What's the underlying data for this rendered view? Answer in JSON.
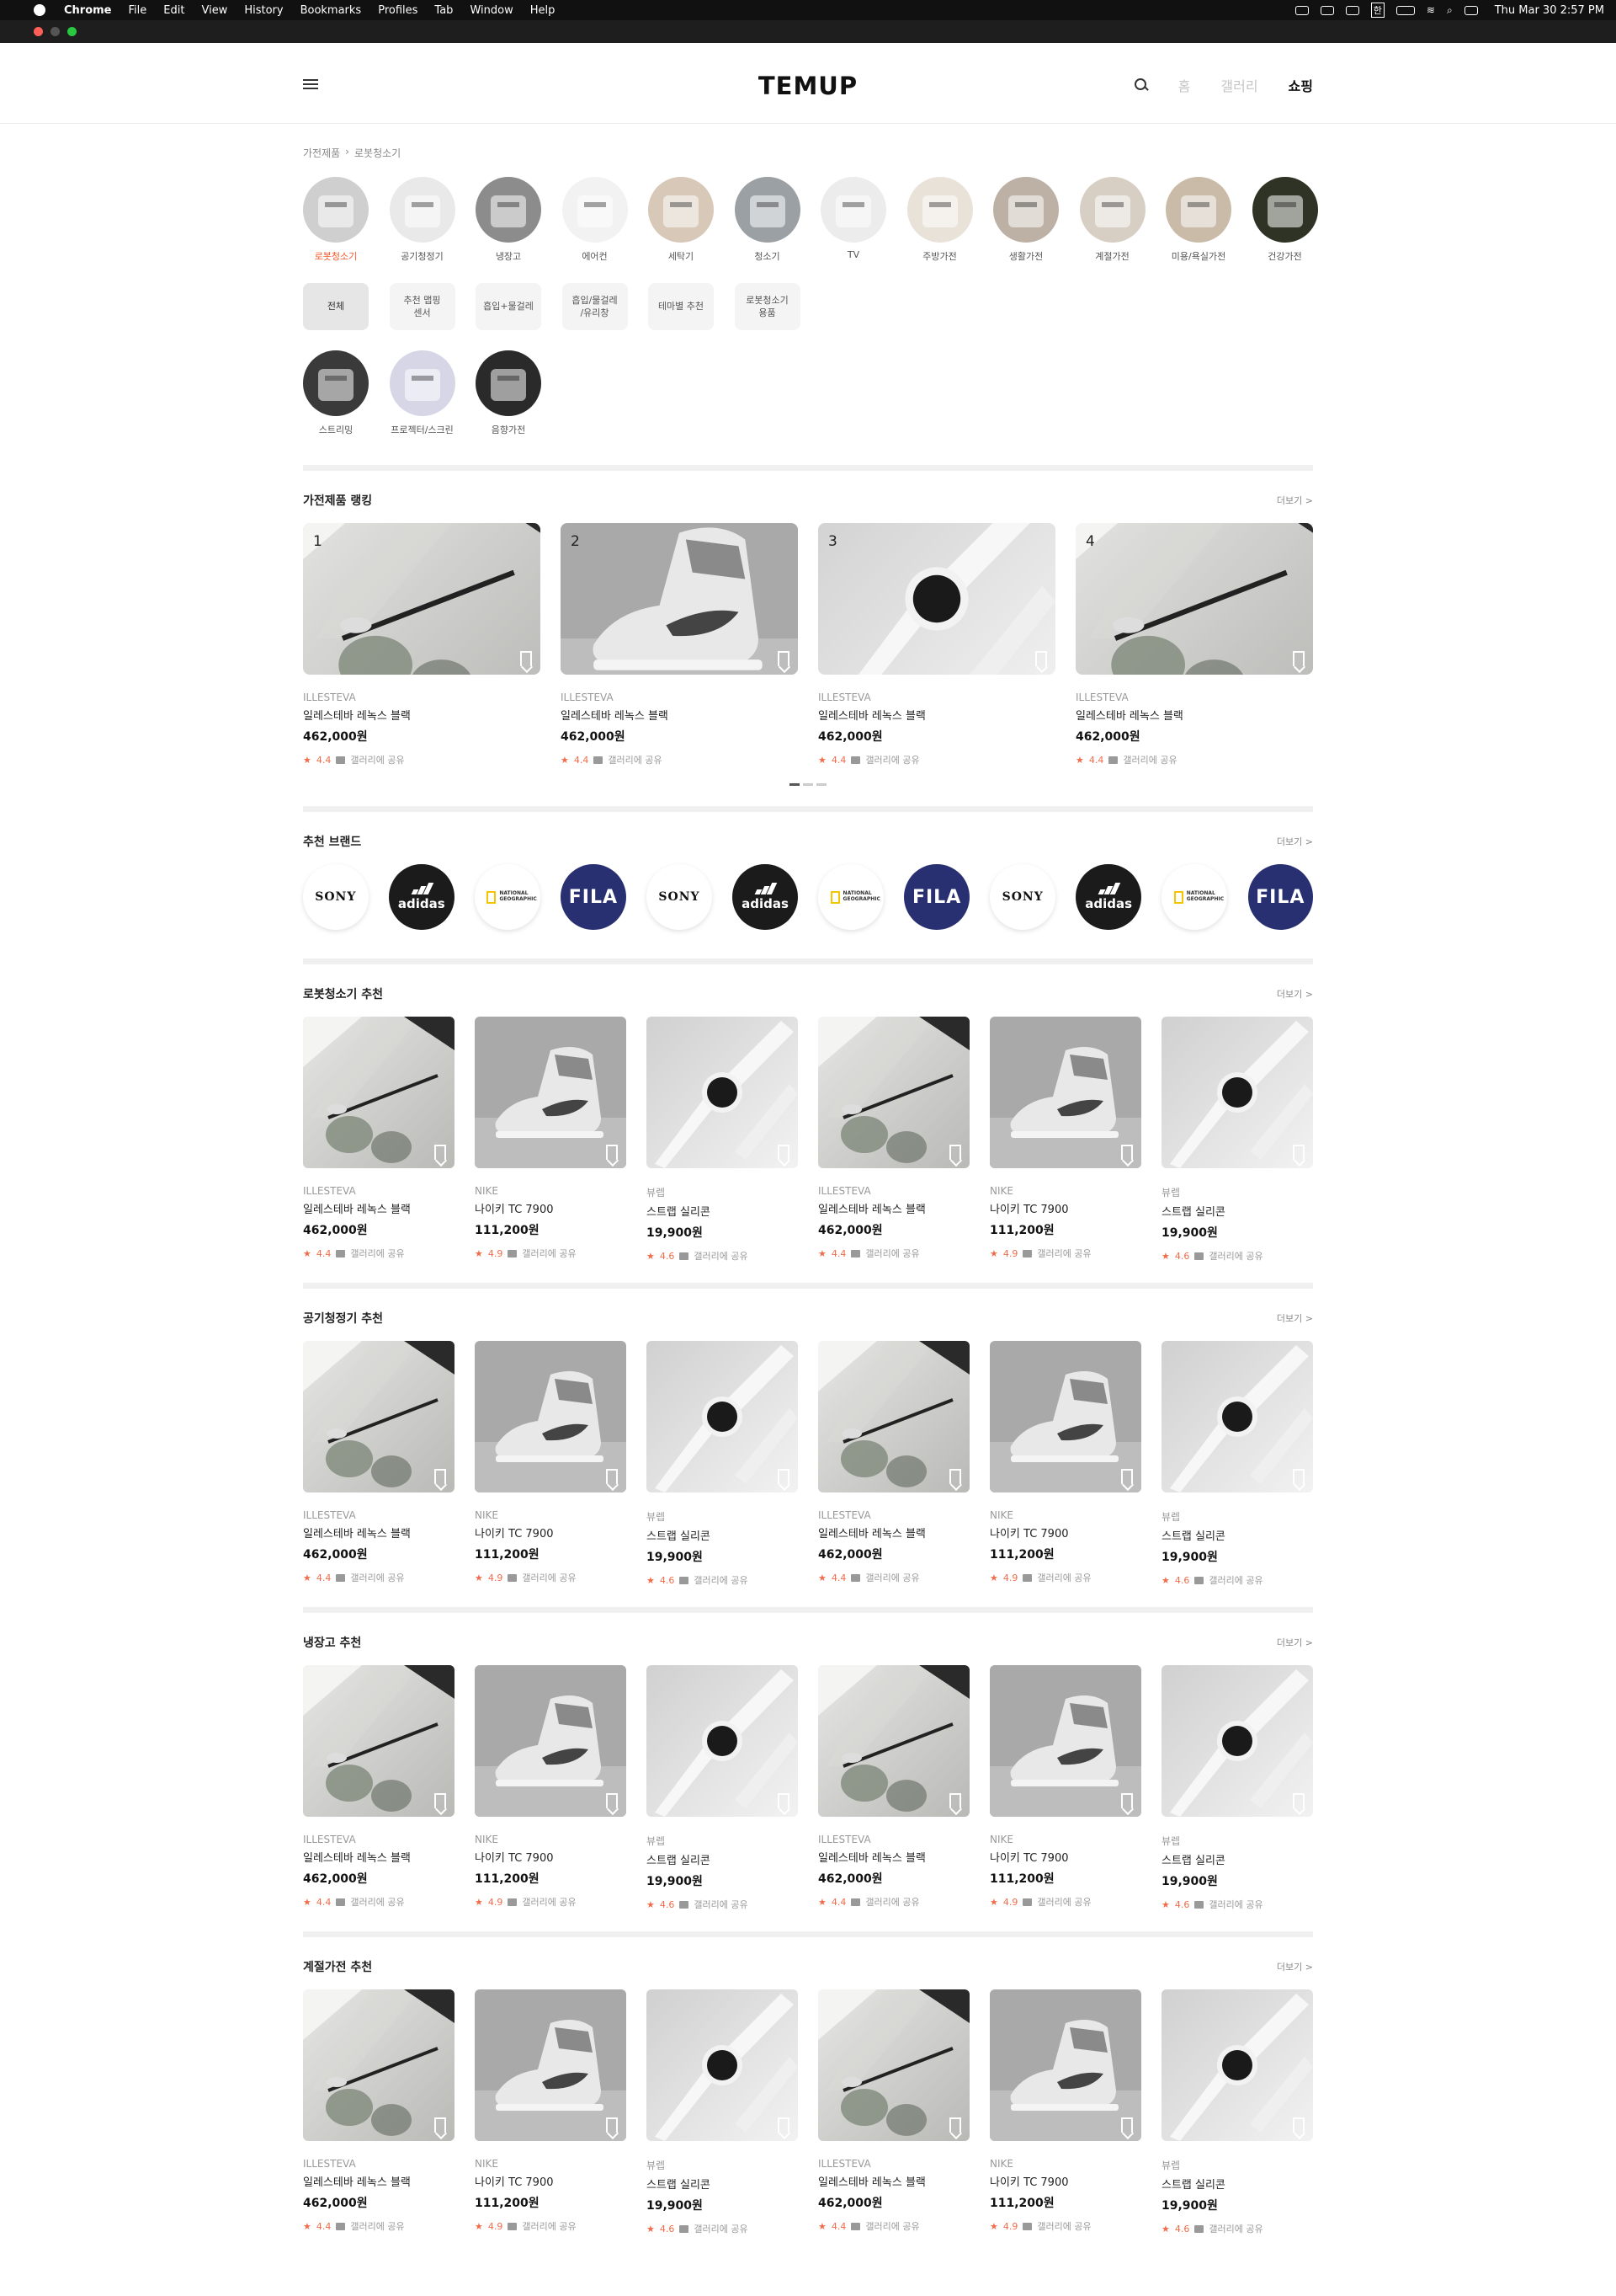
{
  "menubar": {
    "app": "Chrome",
    "items": [
      "File",
      "Edit",
      "View",
      "History",
      "Bookmarks",
      "Profiles",
      "Tab",
      "Window",
      "Help"
    ],
    "clock": "Thu Mar 30  2:57 PM",
    "ime": "한"
  },
  "header": {
    "logo": "TEMUP",
    "nav": [
      "홈",
      "갤러리",
      "쇼핑"
    ],
    "active_nav": "쇼핑"
  },
  "breadcrumb": [
    "가전제품",
    "로봇청소기"
  ],
  "categories": [
    {
      "label": "로봇청소기",
      "active": true
    },
    {
      "label": "공기청정기"
    },
    {
      "label": "냉장고"
    },
    {
      "label": "에어컨"
    },
    {
      "label": "세탁기"
    },
    {
      "label": "청소기"
    },
    {
      "label": "TV"
    },
    {
      "label": "주방가전"
    },
    {
      "label": "생활가전"
    },
    {
      "label": "계절가전"
    },
    {
      "label": "미용/욕실가전"
    },
    {
      "label": "건강가전"
    }
  ],
  "subcategories": [
    "전체",
    "추천 맵핑\n센서",
    "흡입+물걸레",
    "흡입/물걸레\n/유리창",
    "테마별 추천",
    "로봇청소기\n용품"
  ],
  "categories_row2": [
    {
      "label": "스트리밍"
    },
    {
      "label": "프로젝터/스크린"
    },
    {
      "label": "음향가전"
    }
  ],
  "ranking": {
    "title": "가전제품 랭킹",
    "more": "더보기 >",
    "items": [
      {
        "rank": "1",
        "brand": "ILLESTEVA",
        "name": "일레스테바 레녹스 블랙",
        "price": "462,000원",
        "rating": "4.4",
        "share": "갤러리에 공유",
        "img": "glasses"
      },
      {
        "rank": "2",
        "brand": "ILLESTEVA",
        "name": "일레스테바 레녹스 블랙",
        "price": "462,000원",
        "rating": "4.4",
        "share": "갤러리에 공유",
        "img": "shoe"
      },
      {
        "rank": "3",
        "brand": "ILLESTEVA",
        "name": "일레스테바 레녹스 블랙",
        "price": "462,000원",
        "rating": "4.4",
        "share": "갤러리에 공유",
        "img": "watch"
      },
      {
        "rank": "4",
        "brand": "ILLESTEVA",
        "name": "일레스테바 레녹스 블랙",
        "price": "462,000원",
        "rating": "4.4",
        "share": "갤러리에 공유",
        "img": "glasses"
      }
    ]
  },
  "brands": {
    "title": "추천 브랜드",
    "more": "더보기 >",
    "items": [
      "SONY",
      "adidas",
      "NATIONAL GEOGRAPHIC",
      "FILA",
      "SONY",
      "adidas",
      "NATIONAL GEOGRAPHIC",
      "FILA",
      "SONY",
      "adidas",
      "NATIONAL GEOGRAPHIC",
      "FILA"
    ]
  },
  "sections": [
    {
      "title": "로봇청소기 추천",
      "more": "더보기 >"
    },
    {
      "title": "공기청정기 추천",
      "more": "더보기 >"
    },
    {
      "title": "냉장고 추천",
      "more": "더보기 >"
    },
    {
      "title": "계절가전 추천",
      "more": "더보기 >"
    }
  ],
  "products": [
    {
      "brand": "ILLESTEVA",
      "name": "일레스테바 레녹스 블랙",
      "price": "462,000원",
      "rating": "4.4",
      "share": "갤러리에 공유",
      "img": "glasses"
    },
    {
      "brand": "NIKE",
      "name": "나이키 TC 7900",
      "price": "111,200원",
      "rating": "4.9",
      "share": "갤러리에 공유",
      "img": "shoe"
    },
    {
      "brand": "뷰렙",
      "name": "스트랩 실리콘",
      "price": "19,900원",
      "rating": "4.6",
      "share": "갤러리에 공유",
      "img": "watch"
    },
    {
      "brand": "ILLESTEVA",
      "name": "일레스테바 레녹스 블랙",
      "price": "462,000원",
      "rating": "4.4",
      "share": "갤러리에 공유",
      "img": "glasses"
    },
    {
      "brand": "NIKE",
      "name": "나이키 TC 7900",
      "price": "111,200원",
      "rating": "4.9",
      "share": "갤러리에 공유",
      "img": "shoe"
    },
    {
      "brand": "뷰렙",
      "name": "스트랩 실리콘",
      "price": "19,900원",
      "rating": "4.6",
      "share": "갤러리에 공유",
      "img": "watch"
    }
  ],
  "colors": {
    "accent": "#f0582a",
    "rating": "#f26b4a",
    "fila": "#283071"
  }
}
